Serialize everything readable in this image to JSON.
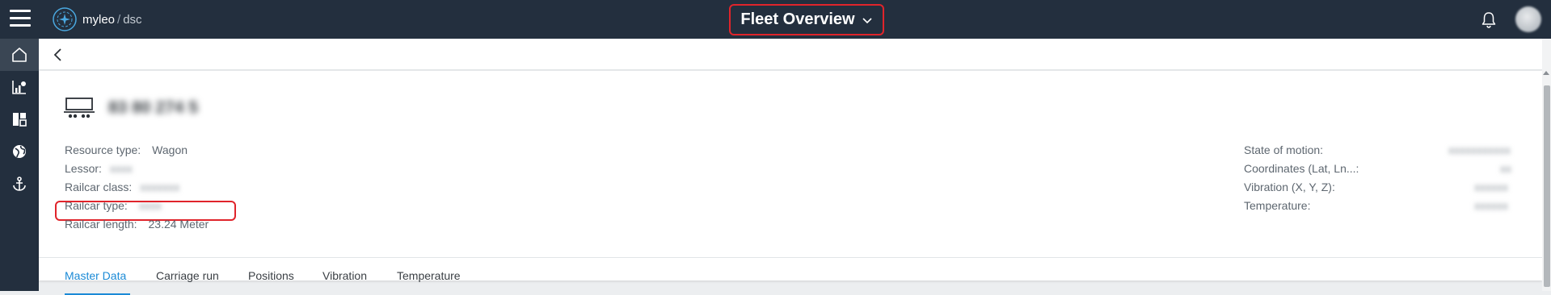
{
  "topbar": {
    "logo_name": "myleo",
    "logo_sep": "/",
    "logo_product": "dsc",
    "title": "Fleet Overview",
    "icons": [
      "menu-icon",
      "logo-icon",
      "chevron-down-icon",
      "bell-icon",
      "avatar"
    ]
  },
  "sidebar": {
    "items": [
      {
        "name": "home",
        "icon": "home-icon",
        "active": true
      },
      {
        "name": "analytics",
        "icon": "chart-icon"
      },
      {
        "name": "dashboard",
        "icon": "dashboard-icon"
      },
      {
        "name": "map",
        "icon": "globe-icon"
      },
      {
        "name": "anchor",
        "icon": "anchor-icon"
      }
    ]
  },
  "resource": {
    "id": "83 80 274 5 ",
    "icon": "wagon-icon",
    "left": [
      {
        "label": "Resource type:",
        "value": "Wagon"
      },
      {
        "label": "Lessor:",
        "value": "",
        "hidden": true
      },
      {
        "label": "Railcar class:",
        "value": "",
        "hidden": true
      },
      {
        "label": "Railcar type:",
        "value": "",
        "hidden": true
      },
      {
        "label": "Railcar length:",
        "value": "23.24 Meter"
      }
    ],
    "right": [
      {
        "label": "State of motion:",
        "value": "",
        "hidden": true
      },
      {
        "label": "Coordinates (Lat, Ln...:",
        "value": "",
        "hidden": true
      },
      {
        "label": "Vibration (X, Y, Z):",
        "value": "",
        "hidden": true
      },
      {
        "label": "Temperature:",
        "value": "",
        "hidden": true
      }
    ]
  },
  "tabs": [
    {
      "label": "Master Data",
      "active": true
    },
    {
      "label": "Carriage run"
    },
    {
      "label": "Positions"
    },
    {
      "label": "Vibration"
    },
    {
      "label": "Temperature"
    }
  ],
  "colors": {
    "topbar": "#232f3e",
    "accent": "#1b8ad6",
    "highlight": "#e0242b"
  }
}
